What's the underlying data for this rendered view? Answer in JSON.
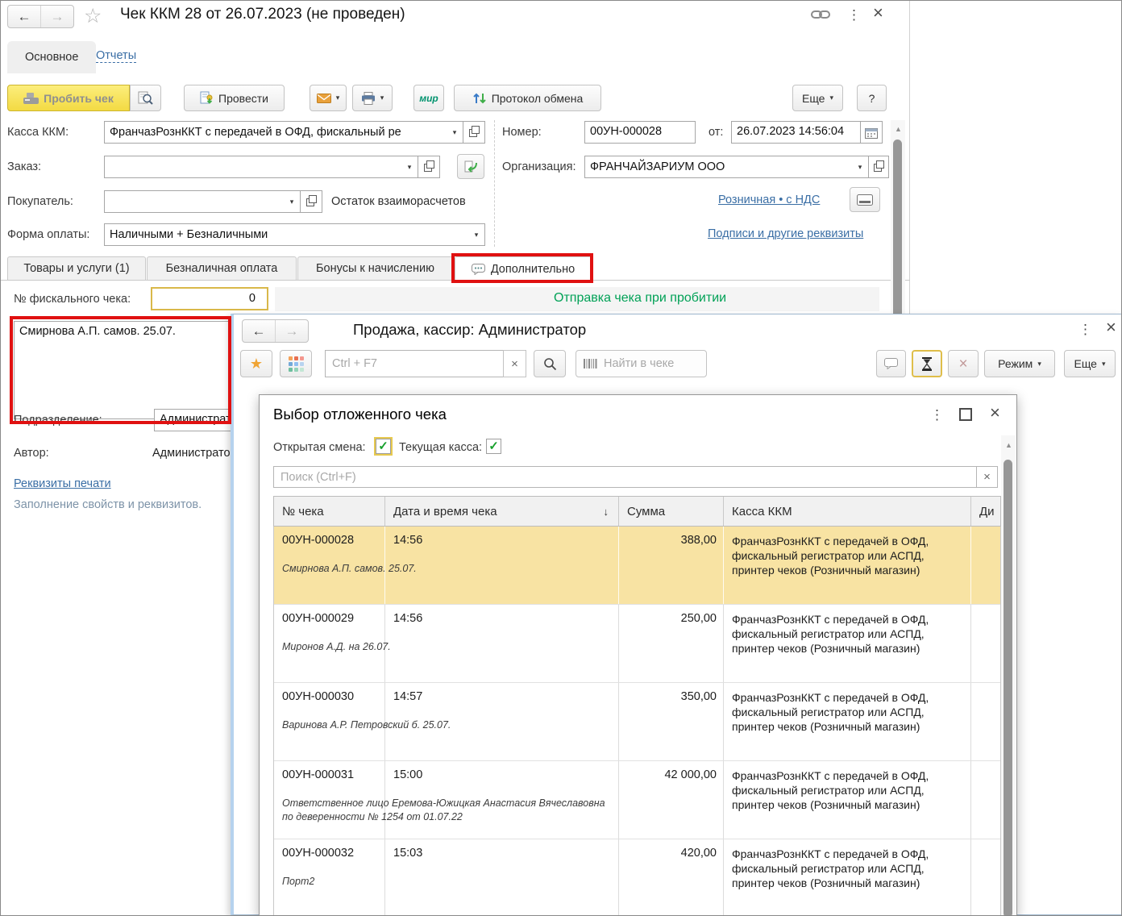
{
  "window_main": {
    "title": "Чек ККМ 28 от 26.07.2023 (не проведен)",
    "nav_tabs": {
      "main": "Основное",
      "reports": "Отчеты"
    },
    "toolbar": {
      "punch_check": "Пробить чек",
      "post": "Провести",
      "mir_badge": "мир",
      "exchange_protocol": "Протокол обмена",
      "more": "Еще",
      "help": "?"
    },
    "form": {
      "kkm_label": "Касса ККМ:",
      "kkm_value": "ФранчазРознККТ с передачей в ОФД, фискальный ре",
      "number_label": "Номер:",
      "number_value": "00УН-000028",
      "date_label": "от:",
      "date_value": "26.07.2023 14:56:04",
      "order_label": "Заказ:",
      "order_value": "",
      "org_label": "Организация:",
      "org_value": "ФРАНЧАЙЗАРИУМ ООО",
      "buyer_label": "Покупатель:",
      "buyer_value": "",
      "mutual_balance": "Остаток взаиморасчетов",
      "taxation_link": "Розничная • с НДС",
      "payment_label": "Форма оплаты:",
      "payment_value": "Наличными + Безналичными",
      "signatures_link": "Подписи и другие реквизиты"
    },
    "doc_tabs": {
      "goods": "Товары и услуги (1)",
      "cashless": "Безналичная оплата",
      "bonuses": "Бонусы к начислению",
      "additional": "Дополнительно"
    },
    "additional_tab": {
      "fiscal_label": "№ фискального чека:",
      "fiscal_value": "0",
      "send_status": "Отправка чека при пробитии",
      "comment": "Смирнова А.П. самов. 25.07.",
      "department_label": "Подразделение:",
      "department_value": "Администратор",
      "author_label": "Автор:",
      "author_value": "Администратор",
      "print_requisites_link": "Реквизиты печати",
      "fill_properties_link": "Заполнение свойств и реквизитов."
    }
  },
  "window_sale": {
    "title": "Продажа, кассир: Администратор",
    "quick_search_placeholder": "Ctrl + F7",
    "find_in_check_placeholder": "Найти в чеке",
    "mode_button": "Режим",
    "more_button": "Еще"
  },
  "dialog_deferred": {
    "title": "Выбор отложенного чека",
    "open_shift_label": "Открытая смена:",
    "current_kassa_label": "Текущая касса:",
    "search_placeholder": "Поиск (Ctrl+F)",
    "table": {
      "headers": {
        "number": "№ чека",
        "datetime": "Дата и время чека",
        "sum": "Сумма",
        "kassa": "Касса ККМ",
        "last_clipped": "Ди"
      },
      "rows": [
        {
          "number": "00УН-000028",
          "time": "14:56",
          "sum": "388,00",
          "kassa": "ФранчазРознККТ с передачей в ОФД, фискальный регистратор или АСПД, принтер чеков (Розничный магазин)",
          "comment": "Смирнова А.П. самов. 25.07.",
          "highlighted": true
        },
        {
          "number": "00УН-000029",
          "time": "14:56",
          "sum": "250,00",
          "kassa": "ФранчазРознККТ с передачей в ОФД, фискальный регистратор или АСПД, принтер чеков (Розничный магазин)",
          "comment": "Миронов А.Д. на 26.07.",
          "highlighted": false
        },
        {
          "number": "00УН-000030",
          "time": "14:57",
          "sum": "350,00",
          "kassa": "ФранчазРознККТ с передачей в ОФД, фискальный регистратор или АСПД, принтер чеков (Розничный магазин)",
          "comment": "Варинова А.Р. Петровский б. 25.07.",
          "highlighted": false
        },
        {
          "number": "00УН-000031",
          "time": "15:00",
          "sum": "42 000,00",
          "kassa": "ФранчазРознККТ с передачей в ОФД, фискальный регистратор или АСПД, принтер чеков (Розничный магазин)",
          "comment": "Ответственное лицо Еремова-Южицкая Анастасия Вячеславовна по деверенности № 1254 от 01.07.22",
          "highlighted": false
        },
        {
          "number": "00УН-000032",
          "time": "15:03",
          "sum": "420,00",
          "kassa": "ФранчазРознККТ с передачей в ОФД, фискальный регистратор или АСПД, принтер чеков (Розничный магазин)",
          "comment": "Порт2",
          "highlighted": false
        }
      ]
    }
  },
  "icons": {
    "back": "←",
    "forward": "→",
    "star_outline": "☆",
    "star_filled": "★",
    "kebab": "⋮",
    "close": "×",
    "caret_down": "▾",
    "sort_down": "↓",
    "check_mark": "✓",
    "scroll_up": "▲",
    "maximize": "□",
    "clear_x": "×"
  },
  "colors": {
    "accent_yellow_button": "#f7e14e",
    "row_highlight": "#f8e3a3",
    "annotation_red": "#e01111",
    "status_green": "#00a156",
    "link_blue": "#3a6ea5",
    "check_green": "#17a02c",
    "focus_yellow": "#e7c94f"
  }
}
